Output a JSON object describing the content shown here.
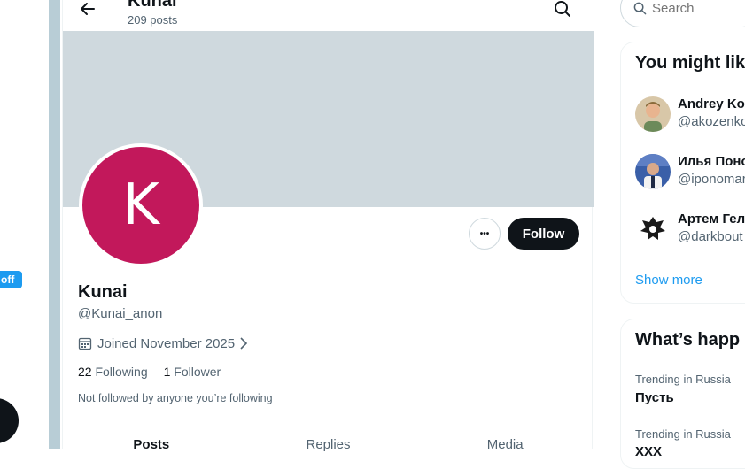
{
  "left": {
    "badge_text": "off"
  },
  "header": {
    "title": "Kunai",
    "posts_count": "209 posts"
  },
  "profile": {
    "avatar_letter": "K",
    "avatar_color": "#c2185b",
    "banner_color": "#cfd9de",
    "display_name": "Kunai",
    "handle": "@Kunai_anon",
    "joined": "Joined November 2025",
    "following_count": "22",
    "following_label": "Following",
    "followers_count": "1",
    "followers_label": "Follower",
    "not_followed": "Not followed by anyone you’re following",
    "follow_label": "Follow",
    "more_label": "•••"
  },
  "tabs": [
    {
      "label": "Posts"
    },
    {
      "label": "Replies"
    },
    {
      "label": "Media"
    }
  ],
  "search": {
    "placeholder": "Search"
  },
  "who_to_follow": {
    "title": "You might like",
    "items": [
      {
        "name": "Andrey Koz",
        "handle": "@akozenko"
      },
      {
        "name": "Илья Поно",
        "handle": "@iponomar"
      },
      {
        "name": "Артем Гелл",
        "handle": "@darkbout"
      }
    ],
    "show_more": "Show more"
  },
  "trending": {
    "title": "What’s happ",
    "items": [
      {
        "context": "Trending in Russia",
        "name": "Пусть"
      },
      {
        "context": "Trending in Russia",
        "name": "ХХХ"
      }
    ]
  },
  "colors": {
    "accent": "#1d9bf0",
    "follow_button": "#0f1419"
  }
}
